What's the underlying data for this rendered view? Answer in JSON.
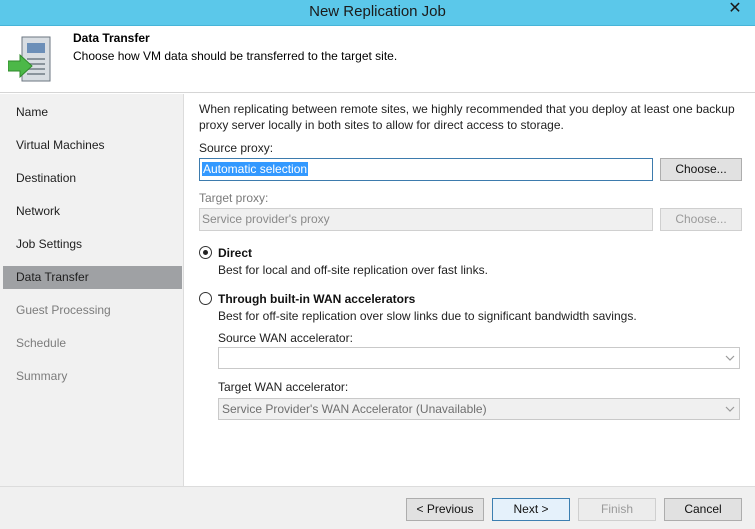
{
  "window": {
    "title": "New Replication Job",
    "close_glyph": "✕"
  },
  "header": {
    "title": "Data Transfer",
    "subtitle": "Choose how VM data should be transferred to the target site.",
    "icon": "data-transfer-wizard-icon"
  },
  "sidebar": {
    "items": [
      {
        "label": "Name",
        "state": "normal"
      },
      {
        "label": "Virtual Machines",
        "state": "normal"
      },
      {
        "label": "Destination",
        "state": "normal"
      },
      {
        "label": "Network",
        "state": "normal"
      },
      {
        "label": "Job Settings",
        "state": "normal"
      },
      {
        "label": "Data Transfer",
        "state": "active"
      },
      {
        "label": "Guest Processing",
        "state": "disabled"
      },
      {
        "label": "Schedule",
        "state": "disabled"
      },
      {
        "label": "Summary",
        "state": "disabled"
      }
    ]
  },
  "main": {
    "intro": "When replicating between remote sites, we highly recommended that you deploy at least one backup proxy server locally in both sites to allow for direct access to storage.",
    "source_proxy": {
      "label": "Source proxy:",
      "value": "Automatic selection",
      "choose_label": "Choose..."
    },
    "target_proxy": {
      "label": "Target proxy:",
      "value": "Service provider's proxy",
      "choose_label": "Choose..."
    },
    "options": [
      {
        "label": "Direct",
        "description": "Best for local and off-site replication over fast links.",
        "selected": true
      },
      {
        "label": "Through built-in WAN accelerators",
        "description": "Best for off-site replication over slow links due to significant bandwidth savings.",
        "selected": false
      }
    ],
    "source_wan": {
      "label": "Source WAN accelerator:",
      "value": ""
    },
    "target_wan": {
      "label": "Target WAN accelerator:",
      "value": "Service Provider's WAN Accelerator (Unavailable)"
    }
  },
  "footer": {
    "previous_label": "< Previous",
    "next_label": "Next >",
    "finish_label": "Finish",
    "cancel_label": "Cancel"
  },
  "colors": {
    "titlebar": "#5bc8ea",
    "active_nav": "#9fa1a4",
    "selection": "#3399ff"
  }
}
